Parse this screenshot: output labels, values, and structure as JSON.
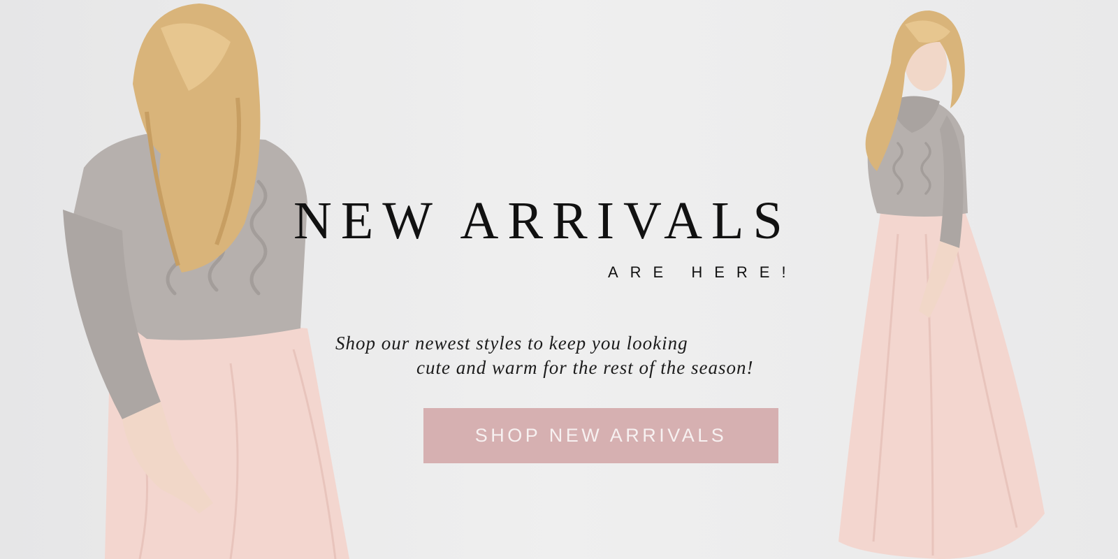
{
  "banner": {
    "headline": "NEW ARRIVALS",
    "subheadline": "ARE HERE!",
    "tagline_line_1": "Shop our newest styles to keep you looking",
    "tagline_line_2": "cute and warm for the rest of the season!",
    "cta_label": "SHOP NEW ARRIVALS"
  },
  "colors": {
    "background": "#ebebeb",
    "headline_text": "#111111",
    "cta_background": "#d6b0b1",
    "cta_text": "#f7f1f1",
    "sweater": "#b6b0ad",
    "skirt": "#f3d6cf",
    "hair": "#d9b47a"
  },
  "images": {
    "left_model": "model-in-grey-sweater-and-blush-skirt",
    "right_model": "model-in-grey-sweater-and-blush-maxi-skirt"
  }
}
